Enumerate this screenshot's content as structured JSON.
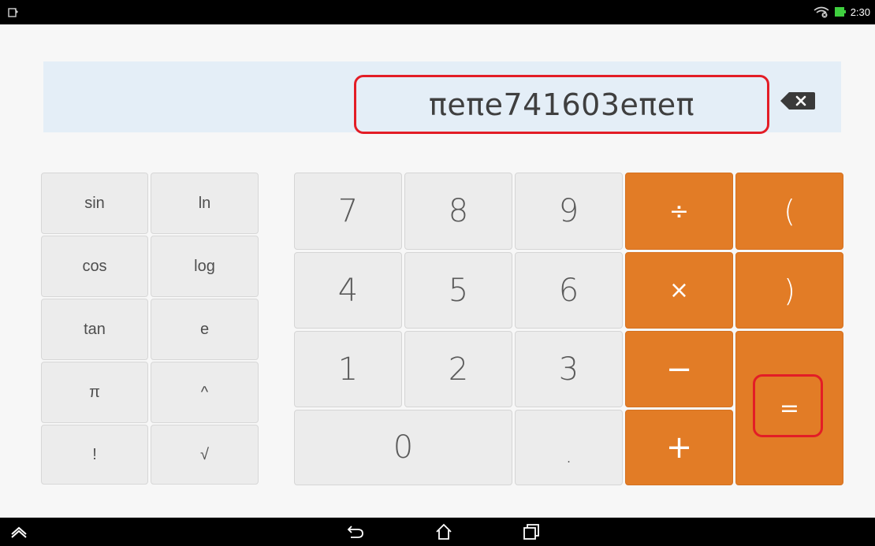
{
  "status_bar": {
    "time": "2:30"
  },
  "display": {
    "expression": "πeπe741603eπeπ"
  },
  "scientific_keys": [
    {
      "label": "sin"
    },
    {
      "label": "ln"
    },
    {
      "label": "cos"
    },
    {
      "label": "log"
    },
    {
      "label": "tan"
    },
    {
      "label": "e"
    },
    {
      "label": "π"
    },
    {
      "label": "^"
    },
    {
      "label": "!"
    },
    {
      "label": "√"
    }
  ],
  "digit_keys": {
    "seven": "7",
    "eight": "8",
    "nine": "9",
    "four": "4",
    "five": "5",
    "six": "6",
    "one": "1",
    "two": "2",
    "three": "3",
    "zero": "0",
    "dot": "."
  },
  "operator_keys": {
    "divide": "÷",
    "open_paren": "(",
    "multiply": "×",
    "close_paren": ")",
    "minus": "−",
    "plus": "+",
    "equals": "="
  },
  "colors": {
    "operator_orange": "#e27c26",
    "display_background": "#e4eef7",
    "highlight_red": "#e31d26"
  },
  "icons": {
    "status_left": "notification-icon",
    "wifi": "wifi-icon",
    "battery": "battery-icon",
    "backspace": "backspace-icon",
    "nav_home_up": "chevron-up-icon",
    "nav_back": "back-icon",
    "nav_home": "home-icon",
    "nav_recents": "recent-apps-icon"
  }
}
